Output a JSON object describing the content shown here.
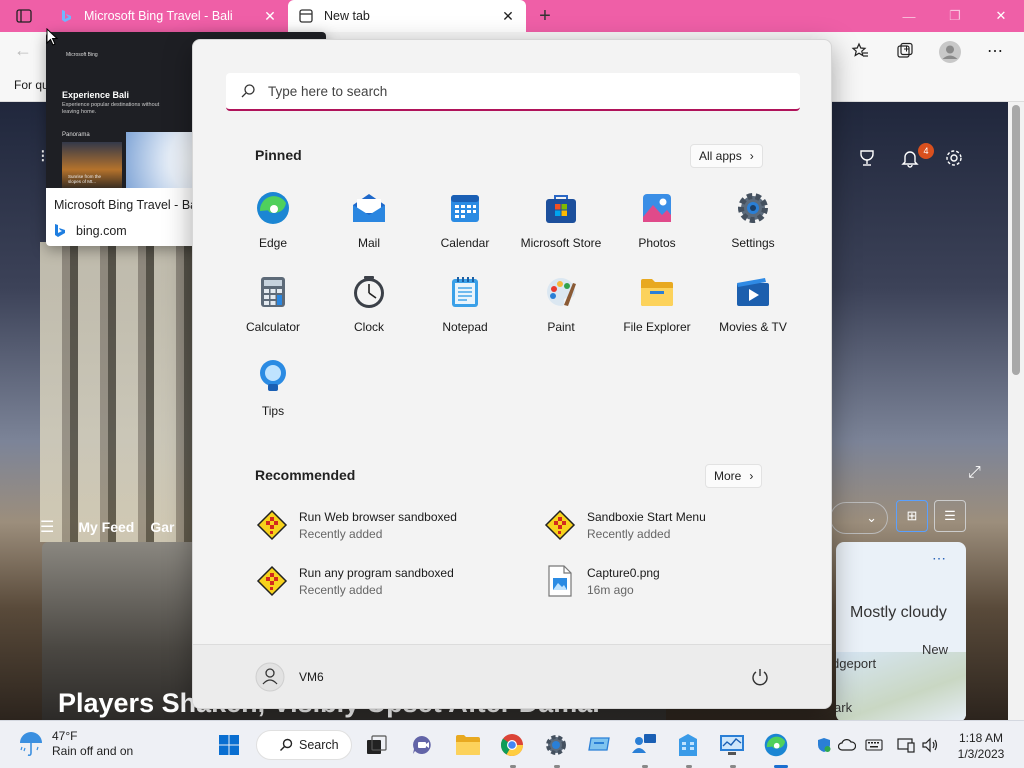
{
  "browser": {
    "tabs": [
      {
        "label": "Microsoft Bing Travel - Bali",
        "active": false
      },
      {
        "label": "New tab",
        "active": true
      }
    ],
    "favorites_bar_text": "For qu",
    "accent_color": "#ef5fa7"
  },
  "tab_preview": {
    "title": "Microsoft Bing Travel - Bali",
    "url": "bing.com",
    "thumb_brand": "Microsoft Bing",
    "thumb_heading": "Experience Bali",
    "thumb_sub": "Experience popular destinations without leaving home.",
    "thumb_section": "Panorama",
    "thumb_caption": "Sunrise from the slopes of Mt..."
  },
  "page": {
    "notification_count": "4",
    "feed_tabs": [
      "My Feed",
      "Gar"
    ],
    "headline": "Players Shaken, Visibly Upset After Damar",
    "weather_condition": "Mostly cloudy",
    "map_labels": [
      "dgeport",
      "Newark",
      "New"
    ]
  },
  "start_menu": {
    "search_placeholder": "Type here to search",
    "pinned_title": "Pinned",
    "all_apps_label": "All apps",
    "pinned": [
      {
        "label": "Edge",
        "icon": "edge-icon"
      },
      {
        "label": "Mail",
        "icon": "mail-icon"
      },
      {
        "label": "Calendar",
        "icon": "calendar-icon"
      },
      {
        "label": "Microsoft Store",
        "icon": "store-icon"
      },
      {
        "label": "Photos",
        "icon": "photos-icon"
      },
      {
        "label": "Settings",
        "icon": "settings-gear-icon"
      },
      {
        "label": "Calculator",
        "icon": "calculator-icon"
      },
      {
        "label": "Clock",
        "icon": "clock-icon"
      },
      {
        "label": "Notepad",
        "icon": "notepad-icon"
      },
      {
        "label": "Paint",
        "icon": "paint-palette-icon"
      },
      {
        "label": "File Explorer",
        "icon": "folder-icon"
      },
      {
        "label": "Movies & TV",
        "icon": "movies-play-icon"
      },
      {
        "label": "Tips",
        "icon": "lightbulb-icon"
      }
    ],
    "recommended_title": "Recommended",
    "more_label": "More",
    "recommended": [
      {
        "name": "Run Web browser sandboxed",
        "sub": "Recently added",
        "icon": "sandboxie-icon"
      },
      {
        "name": "Sandboxie Start Menu",
        "sub": "Recently added",
        "icon": "sandboxie-icon"
      },
      {
        "name": "Run any program sandboxed",
        "sub": "Recently added",
        "icon": "sandboxie-icon"
      },
      {
        "name": "Capture0.png",
        "sub": "16m ago",
        "icon": "image-file-icon"
      }
    ],
    "user_name": "VM6"
  },
  "taskbar": {
    "weather_temp": "47°F",
    "weather_desc": "Rain off and on",
    "search_label": "Search",
    "time": "1:18 AM",
    "date": "1/3/2023"
  }
}
